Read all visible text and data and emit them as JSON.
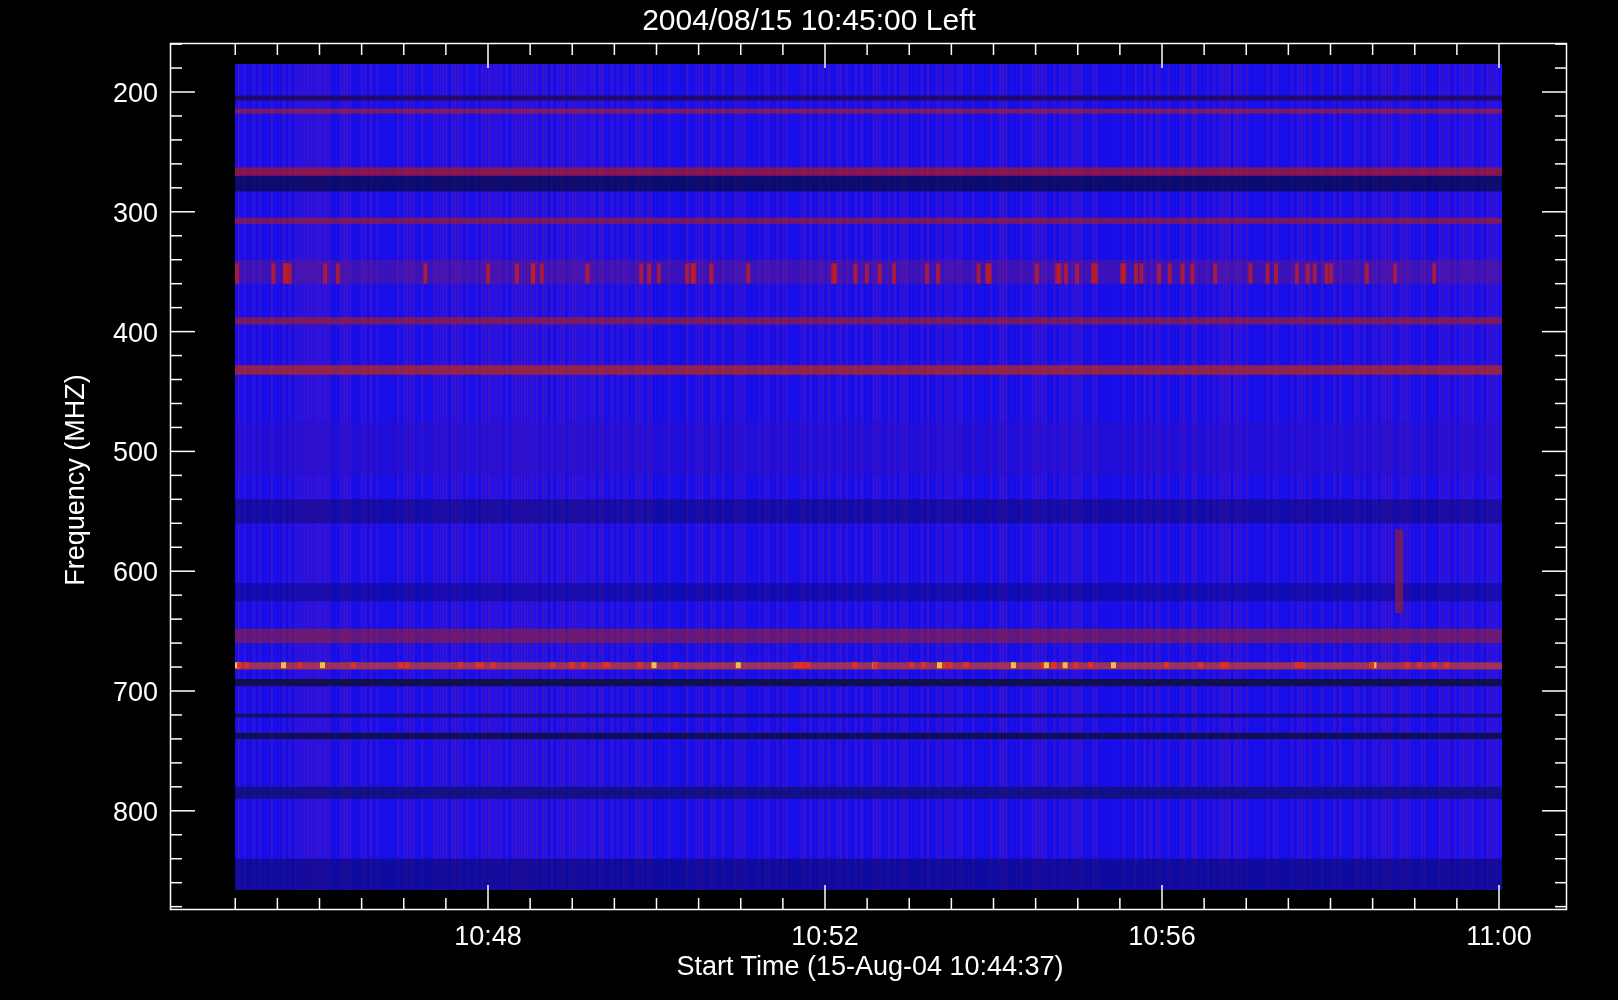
{
  "plot": {
    "title": "2004/08/15 10:45:00 Left",
    "ylabel": "Frequency (MHZ)",
    "xlabel": "Start Time (15-Aug-04 10:44:37)",
    "yticks": [
      "200",
      "300",
      "400",
      "500",
      "600",
      "700",
      "800"
    ],
    "xticks": [
      "10:48",
      "10:52",
      "10:56",
      "11:00"
    ]
  }
}
